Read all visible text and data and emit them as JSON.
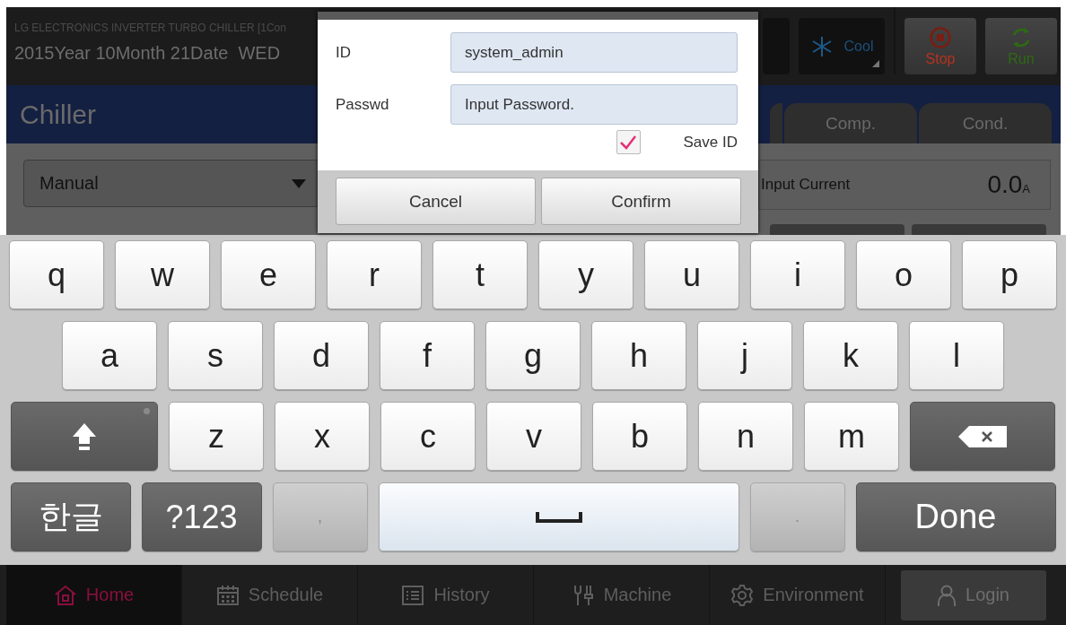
{
  "header": {
    "title": "LG ELECTRONICS INVERTER TURBO CHILLER [1Con",
    "date": "2015Year 10Month 21Date  WED",
    "mode": "Cool",
    "buttons": [
      {
        "label": "Stop",
        "kind": "stop"
      },
      {
        "label": "Run",
        "kind": "run"
      }
    ]
  },
  "page": {
    "title": "Chiller",
    "tabs": [
      {
        "label": "Comp."
      },
      {
        "label": "Cond."
      }
    ]
  },
  "controls": {
    "dropdown": "Manual",
    "reading": {
      "label": "Input Current",
      "value": "0.0",
      "unit": "A"
    }
  },
  "dialog": {
    "fields": [
      {
        "label": "ID",
        "value": "system_admin"
      },
      {
        "label": "Passwd",
        "placeholder": "Input Password."
      }
    ],
    "save_id": {
      "label": "Save ID",
      "checked": true
    },
    "buttons": [
      "Cancel",
      "Confirm"
    ]
  },
  "keyboard": {
    "rows": [
      [
        {
          "kind": "letter",
          "label": "q"
        },
        {
          "kind": "letter",
          "label": "w"
        },
        {
          "kind": "letter",
          "label": "e"
        },
        {
          "kind": "letter",
          "label": "r"
        },
        {
          "kind": "letter",
          "label": "t"
        },
        {
          "kind": "letter",
          "label": "y"
        },
        {
          "kind": "letter",
          "label": "u"
        },
        {
          "kind": "letter",
          "label": "i"
        },
        {
          "kind": "letter",
          "label": "o"
        },
        {
          "kind": "letter",
          "label": "p"
        }
      ],
      [
        {
          "kind": "letter",
          "label": "a"
        },
        {
          "kind": "letter",
          "label": "s"
        },
        {
          "kind": "letter",
          "label": "d"
        },
        {
          "kind": "letter",
          "label": "f"
        },
        {
          "kind": "letter",
          "label": "g"
        },
        {
          "kind": "letter",
          "label": "h"
        },
        {
          "kind": "letter",
          "label": "j"
        },
        {
          "kind": "letter",
          "label": "k"
        },
        {
          "kind": "letter",
          "label": "l"
        }
      ],
      [
        {
          "kind": "shift"
        },
        {
          "kind": "letter",
          "label": "z"
        },
        {
          "kind": "letter",
          "label": "x"
        },
        {
          "kind": "letter",
          "label": "c"
        },
        {
          "kind": "letter",
          "label": "v"
        },
        {
          "kind": "letter",
          "label": "b"
        },
        {
          "kind": "letter",
          "label": "n"
        },
        {
          "kind": "letter",
          "label": "m"
        },
        {
          "kind": "backspace"
        }
      ],
      [
        {
          "kind": "mode",
          "label": "한글"
        },
        {
          "kind": "mode",
          "label": "?123"
        },
        {
          "kind": "punct",
          "label": ","
        },
        {
          "kind": "space"
        },
        {
          "kind": "punct",
          "label": "."
        },
        {
          "kind": "done",
          "label": "Done"
        }
      ]
    ]
  },
  "nav": {
    "items": [
      {
        "label": "Home",
        "kind": "home",
        "selected": true
      },
      {
        "label": "Schedule",
        "kind": "calendar",
        "selected": false
      },
      {
        "label": "History",
        "kind": "list",
        "selected": false
      },
      {
        "label": "Machine",
        "kind": "tools",
        "selected": false
      },
      {
        "label": "Environment",
        "kind": "gear",
        "selected": false
      }
    ],
    "login": "Login"
  }
}
